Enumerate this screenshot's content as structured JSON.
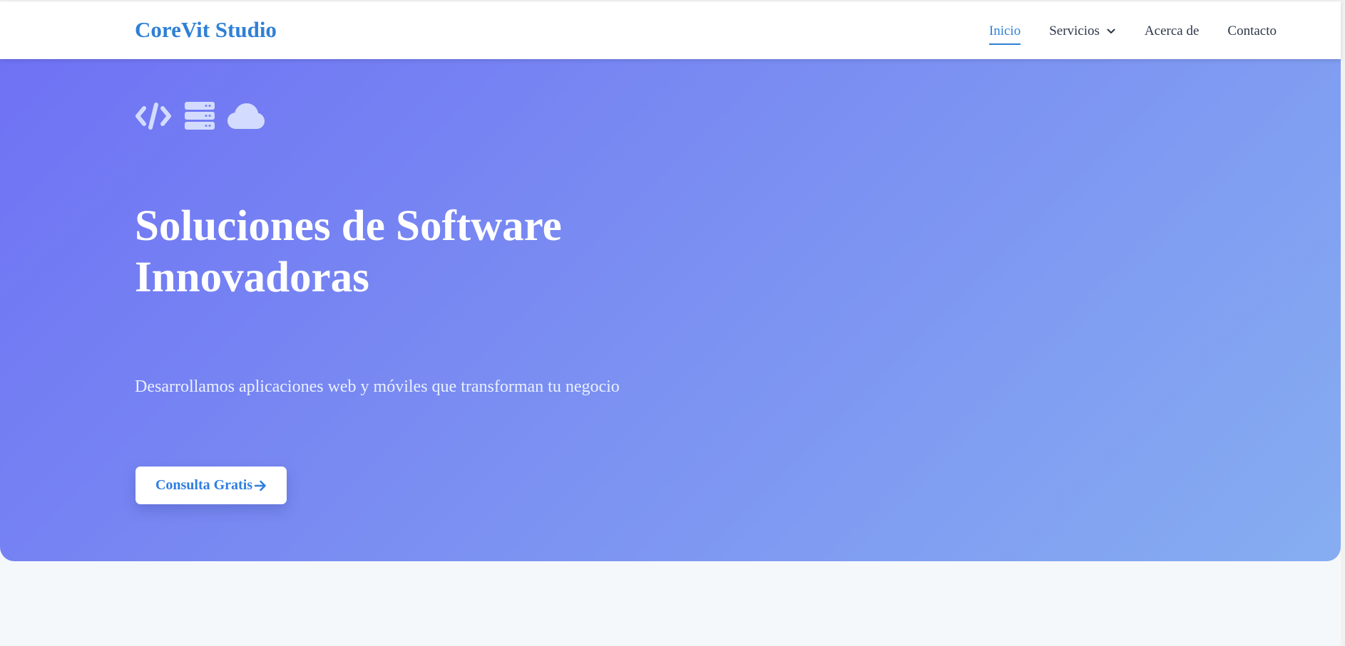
{
  "brand": {
    "name": "CoreVit Studio",
    "color": "#2f80d6"
  },
  "nav": {
    "items": [
      {
        "label": "Inicio",
        "active": true
      },
      {
        "label": "Servicios",
        "dropdown": true,
        "icon": "chevron-down-icon"
      },
      {
        "label": "Acerca de"
      },
      {
        "label": "Contacto"
      }
    ]
  },
  "hero": {
    "icons": [
      "code-icon",
      "server-icon",
      "cloud-icon"
    ],
    "title": "Soluciones de Software Innovadoras",
    "subtitle": "Desarrollamos aplicaciones web y móviles que transforman tu negocio",
    "cta_label": "Consulta Gratis",
    "cta_icon": "arrow-right-icon",
    "gradient": [
      "#6f72f4",
      "#86adf1"
    ]
  }
}
